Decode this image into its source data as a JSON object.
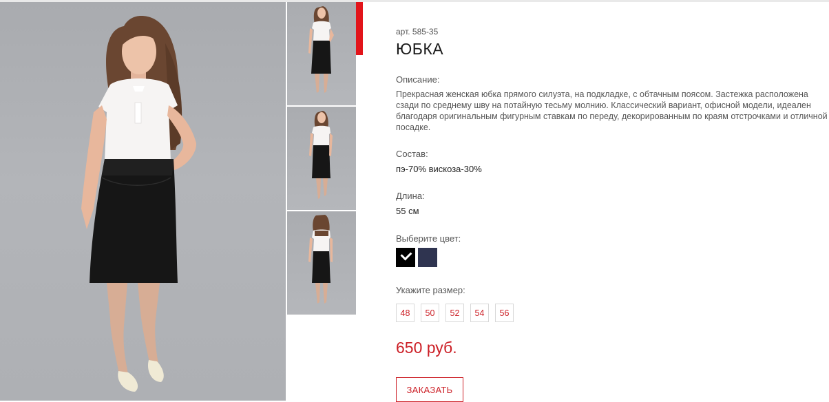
{
  "product": {
    "article": "арт. 585-35",
    "title": "ЮБКА",
    "description_label": "Описание:",
    "description": "Прекрасная женская юбка прямого силуэта, на подкладке, с обтачным поясом. Застежка расположена сзади по среднему шву на потайную тесьму молнию. Классический вариант, офисной модели, идеален благодаря оригинальным фигурным ставкам по переду, декорированным по краям отстрочками и отличной посадке.",
    "composition_label": "Состав:",
    "composition": "пэ-70% вискоза-30%",
    "length_label": "Длина:",
    "length": "55 см",
    "color_label": "Выберите цвет:",
    "colors": [
      {
        "name": "black",
        "hex": "#000000",
        "selected": true
      },
      {
        "name": "navy",
        "hex": "#2f3450",
        "selected": false
      }
    ],
    "size_label": "Укажите размер:",
    "sizes": [
      "48",
      "50",
      "52",
      "54",
      "56"
    ],
    "price": "650 руб.",
    "order_button": "ЗАКАЗАТЬ"
  },
  "gallery": {
    "main_image": "model-front-photo",
    "thumbnails": [
      "model-front-thumb",
      "model-side-thumb",
      "model-back-thumb"
    ],
    "active_thumbnail": 0,
    "accent_color": "#e2141a"
  }
}
